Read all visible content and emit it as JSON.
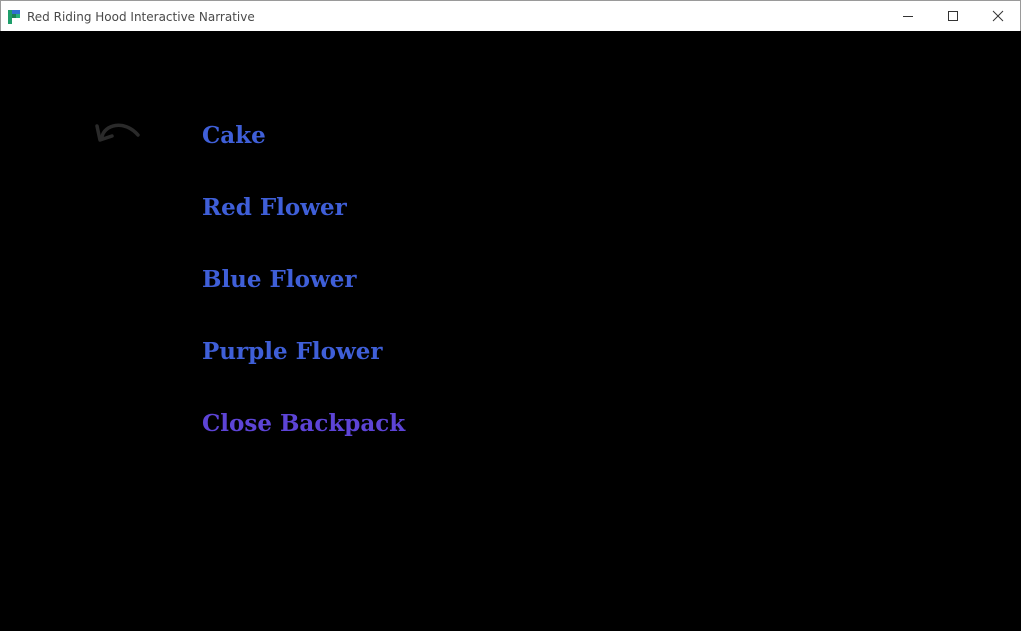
{
  "window": {
    "title": "Red Riding Hood Interactive Narrative",
    "controls": {
      "minimize_icon": "minimize-icon",
      "maximize_icon": "maximize-icon",
      "close_icon": "close-icon"
    }
  },
  "game": {
    "back_icon": "undo-arrow-icon",
    "menu": [
      {
        "label": "Cake"
      },
      {
        "label": "Red Flower"
      },
      {
        "label": "Blue Flower"
      },
      {
        "label": "Purple Flower"
      },
      {
        "label": "Close Backpack"
      }
    ]
  },
  "colors": {
    "background": "#000000",
    "menu_text": "#3f5fd8",
    "menu_text_highlight": "#5d44d6",
    "back_arrow": "#2a2a2a",
    "titlebar": "#ffffff"
  }
}
